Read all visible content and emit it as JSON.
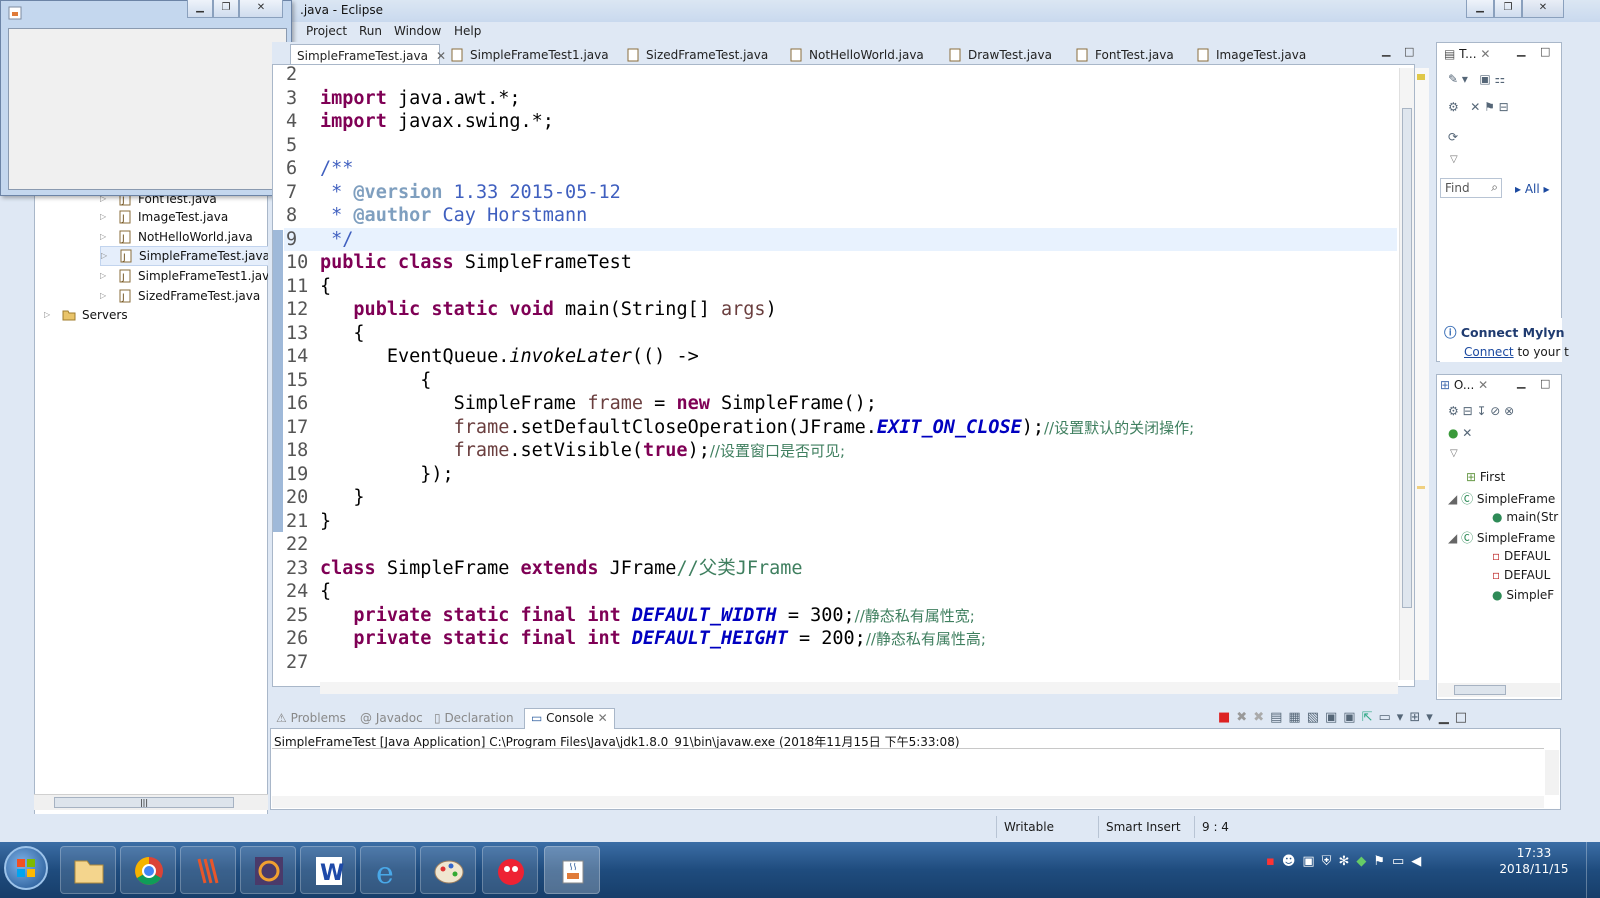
{
  "window": {
    "title": ".java - Eclipse"
  },
  "menu": [
    "Project",
    "Run",
    "Window",
    "Help"
  ],
  "tabs": [
    "SimpleFrameTest.java",
    "SimpleFrameTest1.java",
    "SizedFrameTest.java",
    "NotHelloWorld.java",
    "DrawTest.java",
    "FontTest.java",
    "ImageTest.java"
  ],
  "tree": [
    {
      "label": "FontTest.java"
    },
    {
      "label": "ImageTest.java"
    },
    {
      "label": "NotHelloWorld.java"
    },
    {
      "label": "SimpleFrameTest.java"
    },
    {
      "label": "SimpleFrameTest1.java"
    },
    {
      "label": "SizedFrameTest.java"
    },
    {
      "label": "Servers"
    }
  ],
  "code": {
    "l2": "2",
    "l3": "3",
    "l4": "4",
    "l5": "5",
    "l6": "6",
    "l7": "7",
    "l8": "8",
    "l9": "9",
    "l10": "10",
    "l11": "11",
    "l12": "12",
    "l13": "13",
    "l14": "14",
    "l15": "15",
    "l16": "16",
    "l17": "17",
    "l18": "18",
    "l19": "19",
    "l20": "20",
    "l21": "21",
    "l22": "22",
    "l23": "23",
    "l24": "24",
    "l25": "25",
    "l26": "26",
    "l27": "27",
    "comment_set_close": "//设置默认的关闭操作;",
    "comment_visible": "//设置窗口是否可见;",
    "comment_parent": "//父类JFrame",
    "comment_width": "//静态私有属性宽;",
    "comment_height": "//静态私有属性高;",
    "version": "1.33 2015-05-12",
    "author": "Cay Horstmann"
  },
  "bottom_tabs": [
    "Problems",
    "Javadoc",
    "Declaration",
    "Console"
  ],
  "console_text": "SimpleFrameTest [Java Application] C:\\Program Files\\Java\\jdk1.8.0_91\\bin\\javaw.exe (2018年11月15日 下午5:33:08)",
  "right": {
    "task_title": "T...",
    "find_placeholder": "Find",
    "all_label": "All",
    "mylyn_title": "Connect Mylyn",
    "mylyn_link": "Connect",
    "mylyn_rest": "to your t",
    "outline_title": "O...",
    "outline_items": [
      "First",
      "SimpleFrame",
      "main(Str",
      "SimpleFrame",
      "DEFAUL",
      "DEFAUL",
      "SimpleF"
    ]
  },
  "status": {
    "writable": "Writable",
    "insert": "Smart Insert",
    "position": "9 : 4"
  },
  "clock": {
    "time": "17:33",
    "date": "2018/11/15"
  }
}
